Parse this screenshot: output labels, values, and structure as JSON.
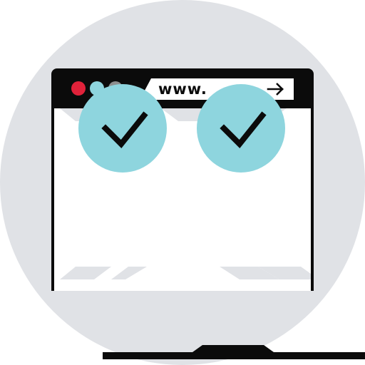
{
  "colors": {
    "background_circle": "#e0e2e6",
    "frame": "#0b0b0b",
    "content": "#ffffff",
    "decor": "#e0e2e6",
    "dot_red": "#e0223a",
    "dot_teal": "#8ed5de",
    "dot_gray": "#8e8e8e",
    "check_circle": "#8ed5de",
    "check_mark": "#0b0b0b"
  },
  "browser": {
    "url_text": "www.",
    "arrow_icon": "arrow-right-icon",
    "window_dots": [
      "close-dot",
      "minimize-dot",
      "maximize-dot"
    ]
  },
  "content": {
    "checks": [
      {
        "icon": "checkmark-icon",
        "state": "checked"
      },
      {
        "icon": "checkmark-icon",
        "state": "checked"
      }
    ]
  }
}
